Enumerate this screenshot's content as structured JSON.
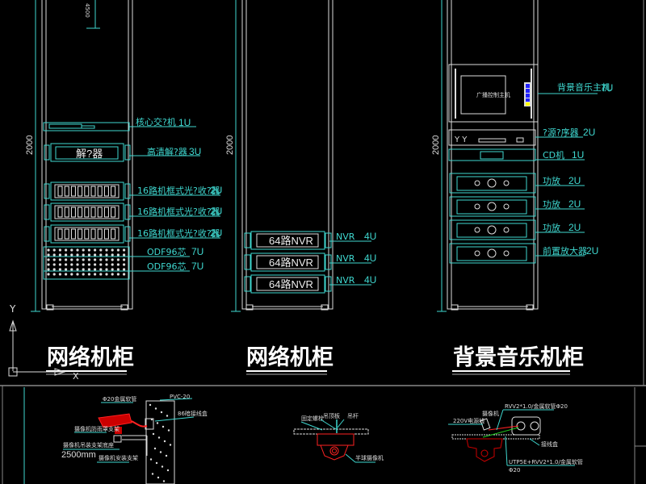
{
  "cabinets": [
    {
      "title": "网络机柜",
      "height_label": "2000",
      "devices": [
        {
          "name": "核心交?机",
          "units": "1U"
        },
        {
          "name": "高清解?器",
          "units": "3U",
          "panel_text": "解?器"
        },
        {
          "name": "16路机框式光?收?器",
          "units": "2U"
        },
        {
          "name": "16路机框式光?收?器",
          "units": "2U"
        },
        {
          "name": "16路机框式光?收?器",
          "units": "2U"
        },
        {
          "name": "ODF96芯",
          "units": "7U"
        },
        {
          "name": "ODF96芯",
          "units": "7U"
        }
      ]
    },
    {
      "title": "网络机柜",
      "height_label": "2000",
      "devices": [
        {
          "name": "NVR",
          "units": "4U",
          "panel_text": "64路NVR"
        },
        {
          "name": "NVR",
          "units": "4U",
          "panel_text": "64路NVR"
        },
        {
          "name": "NVR",
          "units": "4U",
          "panel_text": "64路NVR"
        }
      ]
    },
    {
      "title": "背景音乐机柜",
      "height_label": "2000",
      "devices": [
        {
          "name": "背景音乐主机",
          "units": "7U",
          "panel_text": "广播控制主机"
        },
        {
          "name": "?源?序器",
          "units": "2U"
        },
        {
          "name": "CD机",
          "units": "1U"
        },
        {
          "name": "功放",
          "units": "2U"
        },
        {
          "name": "功放",
          "units": "2U"
        },
        {
          "name": "功放",
          "units": "2U"
        },
        {
          "name": "前置放大器",
          "units": "2U"
        }
      ]
    }
  ],
  "ucs": {
    "y_label": "Y",
    "x_label": "X"
  },
  "details": {
    "wall_camera": {
      "labels": [
        "Φ20金属软管",
        "PVC-20",
        "86暗接线盒",
        "摄像机防雨罩支架",
        "摄像机吊装支架底座",
        "摄像机安装支架"
      ],
      "height_note": "2500mm"
    },
    "dome_camera": {
      "labels": [
        "固定螺栓",
        "吊顶板",
        "吊杆",
        "半球摄像机"
      ]
    },
    "ceiling_camera": {
      "labels": [
        "RVV2*1.0/金属软管Φ20",
        "220V电源线",
        "摄像机",
        "接线盒",
        "UTP5E+RVV2*1.0/金属软管",
        "Φ20"
      ]
    }
  }
}
